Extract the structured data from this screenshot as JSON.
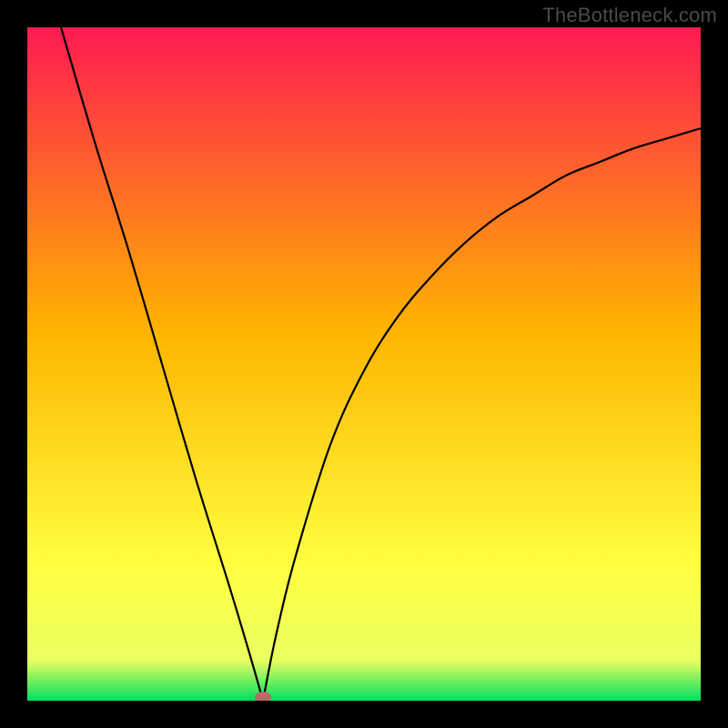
{
  "watermark": "TheBottleneck.com",
  "colors": {
    "background": "#000000",
    "gradient_top": "#ff1a52",
    "gradient_mid": "#ffb400",
    "gradient_low": "#ffff40",
    "gradient_bottom": "#00e060",
    "curve": "#000000",
    "marker": "#b56c66"
  },
  "chart_data": {
    "type": "line",
    "title": "",
    "xlabel": "",
    "ylabel": "",
    "xlim": [
      0,
      100
    ],
    "ylim": [
      0,
      100
    ],
    "grid": false,
    "annotations": [
      {
        "label": "minimum-marker",
        "x": 35,
        "y": 0
      }
    ],
    "series": [
      {
        "name": "left-branch",
        "x": [
          5,
          10,
          15,
          20,
          25,
          30,
          33,
          35
        ],
        "values": [
          100,
          83,
          67,
          50,
          33,
          17,
          7,
          0
        ]
      },
      {
        "name": "right-branch",
        "x": [
          35,
          37,
          40,
          45,
          50,
          55,
          60,
          65,
          70,
          75,
          80,
          85,
          90,
          95,
          100
        ],
        "values": [
          0,
          10,
          22,
          38,
          49,
          57,
          63,
          68,
          72,
          75,
          78,
          80,
          82,
          83.5,
          85
        ]
      }
    ]
  }
}
